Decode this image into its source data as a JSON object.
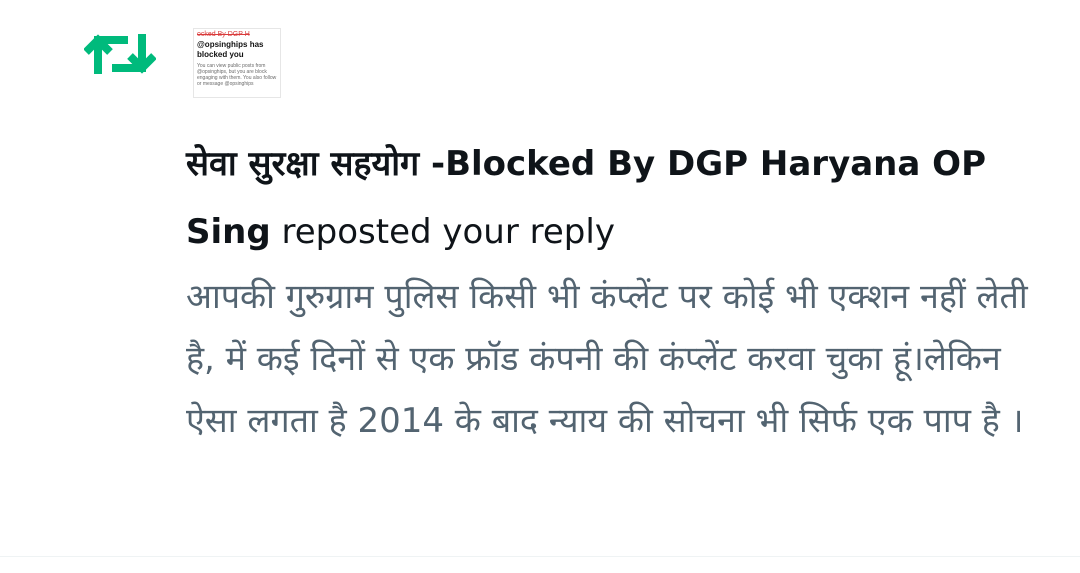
{
  "notification": {
    "type_icon": "repost-icon",
    "icon_color": "#00ba7c",
    "avatar": {
      "icon": "blocked-screenshot-avatar",
      "top_text": "ocked By DGP H",
      "headline": "@opsinghips has blocked you",
      "body": "You can view public posts from @opsinghips, but you are block engaging with them. You also follow or message @opsinghips"
    },
    "user_name": "सेवा सुरक्षा सहयोग -Blocked By DGP Haryana OP Sing",
    "action_text": " reposted your reply",
    "reply_text": "आपकी गुरुग्राम पुलिस किसी भी कंप्लेंट पर कोई भी एक्शन नहीं लेती है, में कई दिनों से एक फ्रॉड कंपनी की कंप्लेंट करवा चुका हूं।लेकिन ऐसा लगता है 2014 के बाद न्याय की सोचना भी सिर्फ एक पाप है ।"
  }
}
